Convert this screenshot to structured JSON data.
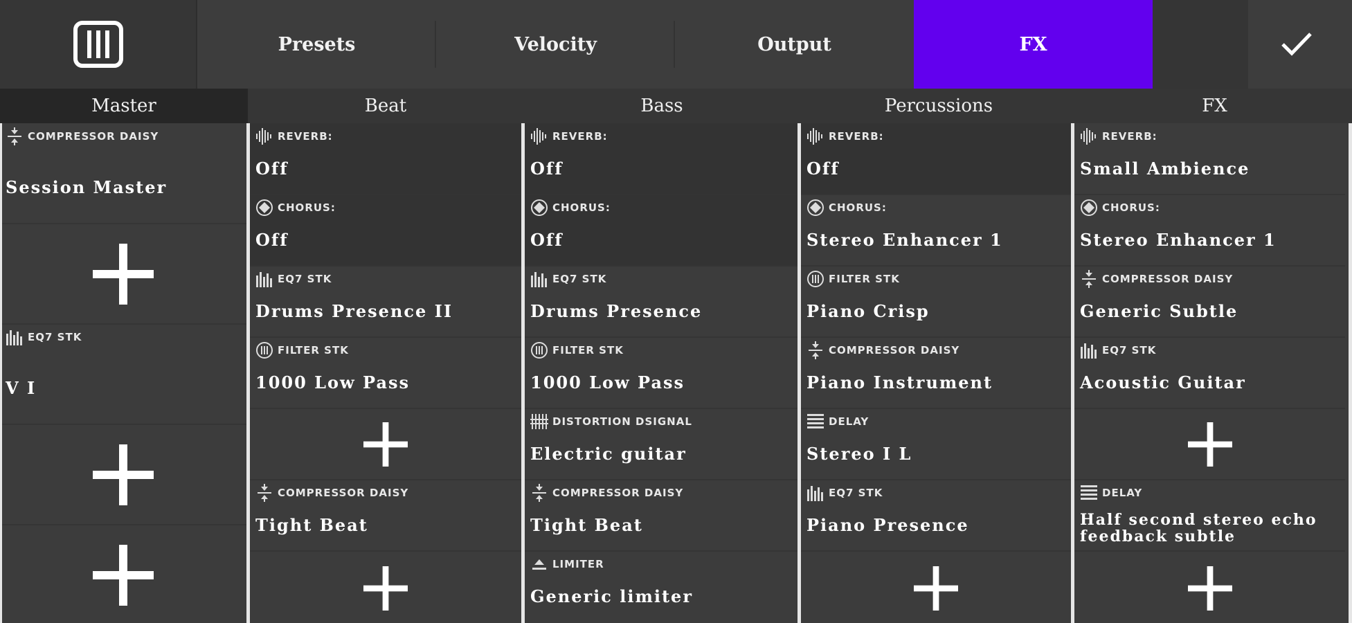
{
  "toolbar": {
    "menu_icon": "piano-keys-icon",
    "tabs": [
      {
        "label": "Presets"
      },
      {
        "label": "Velocity"
      },
      {
        "label": "Output"
      },
      {
        "label": "FX"
      }
    ],
    "active_tab": "FX",
    "active_color": "#6200ee",
    "confirm_icon": "checkmark-icon"
  },
  "columns": [
    {
      "header": "Master",
      "slots": [
        {
          "type": "COMPRESSOR DAISY",
          "icon": "compressor-icon",
          "name": "Session Master"
        },
        {
          "empty": true
        },
        {
          "type": "EQ7 STK",
          "icon": "eq-icon",
          "name": "V I"
        },
        {
          "empty": true
        },
        {
          "empty": true
        }
      ]
    },
    {
      "header": "Beat",
      "slots": [
        {
          "type": "REVERB:",
          "icon": "reverb-icon",
          "name": "Off"
        },
        {
          "type": "CHORUS:",
          "icon": "chorus-icon",
          "name": "Off"
        },
        {
          "type": "EQ7 STK",
          "icon": "eq-icon",
          "name": "Drums Presence II"
        },
        {
          "type": "FILTER STK",
          "icon": "filter-icon",
          "name": "1000 Low Pass"
        },
        {
          "empty": true
        },
        {
          "type": "COMPRESSOR DAISY",
          "icon": "compressor-icon",
          "name": "Tight Beat"
        },
        {
          "empty": true
        }
      ]
    },
    {
      "header": "Bass",
      "slots": [
        {
          "type": "REVERB:",
          "icon": "reverb-icon",
          "name": "Off"
        },
        {
          "type": "CHORUS:",
          "icon": "chorus-icon",
          "name": "Off"
        },
        {
          "type": "EQ7 STK",
          "icon": "eq-icon",
          "name": "Drums Presence"
        },
        {
          "type": "FILTER STK",
          "icon": "filter-icon",
          "name": "1000 Low Pass"
        },
        {
          "type": "DISTORTION DSIGNAL",
          "icon": "distortion-icon",
          "name": "Electric guitar"
        },
        {
          "type": "COMPRESSOR DAISY",
          "icon": "compressor-icon",
          "name": "Tight Beat"
        },
        {
          "type": "LIMITER",
          "icon": "limiter-icon",
          "name": "Generic limiter"
        }
      ]
    },
    {
      "header": "Percussions",
      "slots": [
        {
          "type": "REVERB:",
          "icon": "reverb-icon",
          "name": "Off"
        },
        {
          "type": "CHORUS:",
          "icon": "chorus-icon",
          "name": "Stereo Enhancer 1"
        },
        {
          "type": "FILTER STK",
          "icon": "filter-icon",
          "name": "Piano Crisp"
        },
        {
          "type": "COMPRESSOR DAISY",
          "icon": "compressor-icon",
          "name": "Piano Instrument"
        },
        {
          "type": "DELAY",
          "icon": "delay-icon",
          "name": "Stereo I L"
        },
        {
          "type": "EQ7 STK",
          "icon": "eq-icon",
          "name": "Piano Presence"
        },
        {
          "empty": true
        }
      ]
    },
    {
      "header": "FX",
      "slots": [
        {
          "type": "REVERB:",
          "icon": "reverb-icon",
          "name": "Small Ambience"
        },
        {
          "type": "CHORUS:",
          "icon": "chorus-icon",
          "name": "Stereo Enhancer 1"
        },
        {
          "type": "COMPRESSOR DAISY",
          "icon": "compressor-icon",
          "name": "Generic Subtle"
        },
        {
          "type": "EQ7 STK",
          "icon": "eq-icon",
          "name": "Acoustic Guitar"
        },
        {
          "empty": true
        },
        {
          "type": "DELAY",
          "icon": "delay-icon",
          "name": "Half second stereo echo feedback subtle"
        },
        {
          "empty": true
        }
      ]
    }
  ]
}
